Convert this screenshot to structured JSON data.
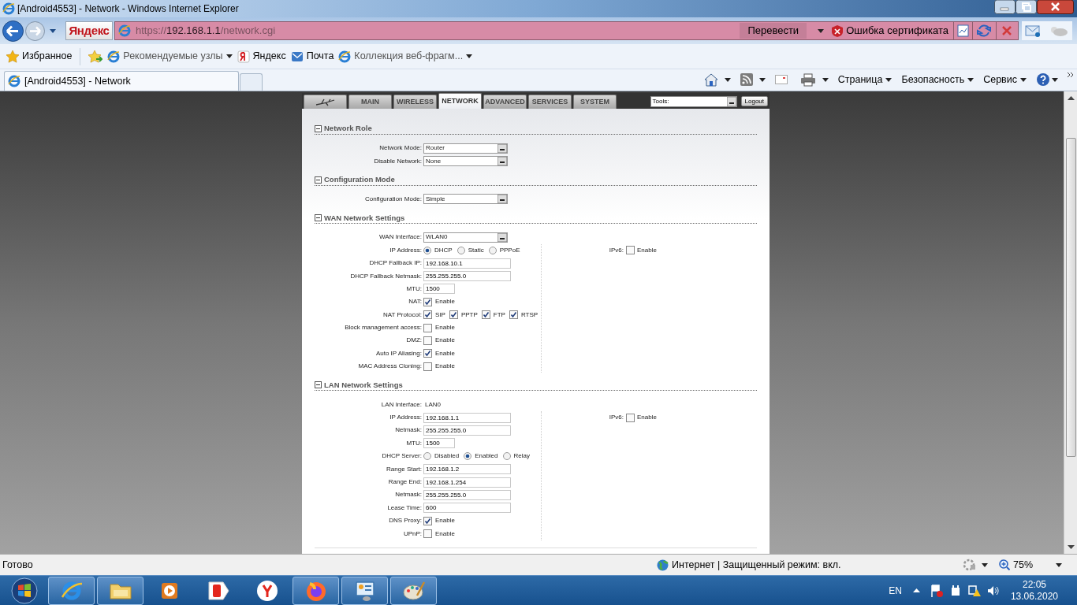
{
  "window": {
    "title": "[Android4553] - Network - Windows Internet Explorer"
  },
  "address_bar": {
    "search_button": "Яндекс",
    "url_scheme": "https://",
    "url_host": "192.168.1.1",
    "url_path": "/network.cgi",
    "translate_button": "Перевести",
    "certificate_error": "Ошибка сертификата"
  },
  "favorites_bar": [
    {
      "kind": "star",
      "label": "Избранное",
      "menu": false
    },
    {
      "kind": "ie",
      "label": "Рекомендуемые узлы",
      "menu": true
    },
    {
      "kind": "yandex",
      "label": "Яндекс",
      "menu": false
    },
    {
      "kind": "mail",
      "label": "Почта",
      "menu": false
    },
    {
      "kind": "ie",
      "label": "Коллекция веб-фрагм...",
      "menu": true
    }
  ],
  "browser_tabs": [
    {
      "label": "[Android4553] - Network",
      "selected": true
    }
  ],
  "command_bar": [
    "Страница",
    "Безопасность",
    "Сервис"
  ],
  "router_tabs": [
    {
      "kind": "logo",
      "selected": false
    },
    {
      "kind": "text",
      "label": "MAIN",
      "selected": false
    },
    {
      "kind": "text",
      "label": "WIRELESS",
      "selected": false
    },
    {
      "kind": "text",
      "label": "NETWORK",
      "selected": true
    },
    {
      "kind": "text",
      "label": "ADVANCED",
      "selected": false
    },
    {
      "kind": "text",
      "label": "SERVICES",
      "selected": false
    },
    {
      "kind": "text",
      "label": "SYSTEM",
      "selected": false
    }
  ],
  "tools_select": {
    "value": "Tools:"
  },
  "logout_button": "Logout",
  "sections": [
    {
      "title": "Network Role",
      "expanded": true,
      "rows": [
        {
          "label": "Network Mode:",
          "kind": "select",
          "value": "Router"
        },
        {
          "label": "Disable Network:",
          "kind": "select",
          "value": "None"
        }
      ]
    },
    {
      "title": "Configuration Mode",
      "expanded": true,
      "rows": [
        {
          "label": "Configuration Mode:",
          "kind": "select",
          "value": "Simple"
        }
      ]
    },
    {
      "title": "WAN Network Settings",
      "expanded": true,
      "rows": [
        {
          "label": "WAN Interface:",
          "kind": "select",
          "value": "WLAN0"
        }
      ],
      "column_rows": [
        {
          "label": "IP Address:",
          "kind": "radio",
          "options": [
            {
              "label": "DHCP",
              "selected": true
            },
            {
              "label": "Static",
              "selected": false
            },
            {
              "label": "PPPoE",
              "selected": false
            }
          ]
        },
        {
          "label": "DHCP Fallback IP:",
          "kind": "input",
          "value": "192.168.10.1"
        },
        {
          "label": "DHCP Fallback Netmask:",
          "kind": "input",
          "value": "255.255.255.0"
        },
        {
          "label": "MTU:",
          "kind": "short",
          "value": "1500"
        },
        {
          "label": "NAT:",
          "kind": "checks",
          "options": [
            {
              "label": "Enable",
              "checked": true
            }
          ]
        },
        {
          "label": "NAT Protocol:",
          "kind": "checks",
          "options": [
            {
              "label": "SIP",
              "checked": true
            },
            {
              "label": "PPTP",
              "checked": true
            },
            {
              "label": "FTP",
              "checked": true
            },
            {
              "label": "RTSP",
              "checked": true
            }
          ]
        },
        {
          "label": "Block management access:",
          "kind": "checks",
          "options": [
            {
              "label": "Enable",
              "checked": false
            }
          ]
        },
        {
          "label": "DMZ:",
          "kind": "checks",
          "options": [
            {
              "label": "Enable",
              "checked": false
            }
          ]
        },
        {
          "label": "Auto IP Aliasing:",
          "kind": "checks",
          "options": [
            {
              "label": "Enable",
              "checked": true
            }
          ]
        },
        {
          "label": "MAC Address Cloning:",
          "kind": "checks",
          "options": [
            {
              "label": "Enable",
              "checked": false
            }
          ]
        }
      ],
      "side": {
        "label": "IPv6:",
        "option": "Enable",
        "checked": false
      }
    },
    {
      "title": "LAN Network Settings",
      "expanded": true,
      "rows": [
        {
          "label": "LAN Interface:",
          "kind": "static",
          "value": "LAN0"
        }
      ],
      "column_rows": [
        {
          "label": "IP Address:",
          "kind": "input",
          "value": "192.168.1.1"
        },
        {
          "label": "Netmask:",
          "kind": "input",
          "value": "255.255.255.0"
        },
        {
          "label": "MTU:",
          "kind": "short",
          "value": "1500"
        },
        {
          "label": "DHCP Server:",
          "kind": "radio",
          "options": [
            {
              "label": "Disabled",
              "selected": false
            },
            {
              "label": "Enabled",
              "selected": true
            },
            {
              "label": "Relay",
              "selected": false
            }
          ]
        },
        {
          "label": "Range Start:",
          "kind": "input",
          "value": "192.168.1.2"
        },
        {
          "label": "Range End:",
          "kind": "input",
          "value": "192.168.1.254"
        },
        {
          "label": "Netmask:",
          "kind": "input",
          "value": "255.255.255.0"
        },
        {
          "label": "Lease Time:",
          "kind": "input",
          "value": "600"
        },
        {
          "label": "DNS Proxy:",
          "kind": "checks",
          "options": [
            {
              "label": "Enable",
              "checked": true
            }
          ]
        },
        {
          "label": "UPnP:",
          "kind": "checks",
          "options": [
            {
              "label": "Enable",
              "checked": false
            }
          ]
        }
      ],
      "side": {
        "label": "IPv6:",
        "option": "Enable",
        "checked": false
      }
    }
  ],
  "status_bar": {
    "status": "Готово",
    "zone": "Интернет | Защищенный режим: вкл.",
    "zoom": "75%"
  },
  "taskbar": {
    "apps": [
      {
        "kind": "ie",
        "running": true
      },
      {
        "kind": "folder",
        "running": true
      },
      {
        "kind": "player",
        "running": false
      },
      {
        "kind": "yabrowser",
        "running": false
      },
      {
        "kind": "yandex",
        "running": false
      },
      {
        "kind": "firefox",
        "running": true
      },
      {
        "kind": "panel",
        "running": true
      },
      {
        "kind": "paint",
        "running": true
      }
    ],
    "language": "EN",
    "time": "22:05",
    "date": "13.06.2020"
  }
}
